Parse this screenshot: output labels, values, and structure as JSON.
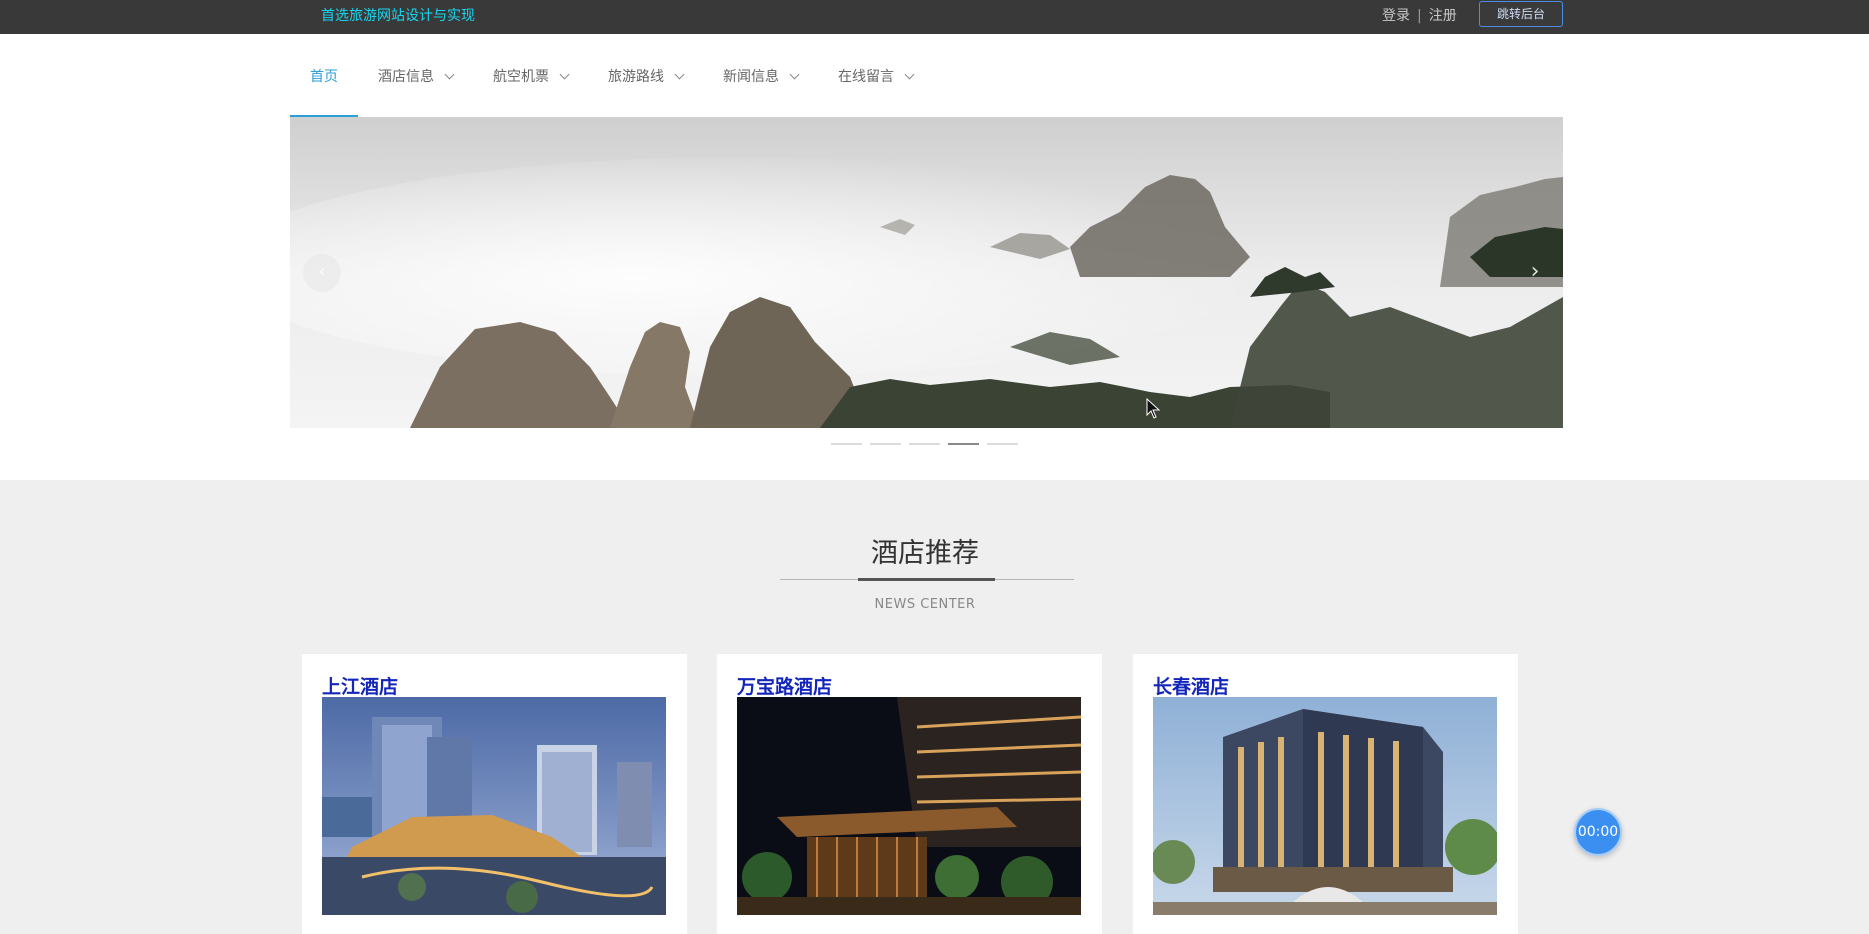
{
  "topbar": {
    "site_title": "首选旅游网站设计与实现",
    "login": "登录",
    "separator": "|",
    "register": "注册",
    "admin_button": "跳转后台"
  },
  "nav": {
    "items": [
      {
        "label": "首页",
        "active": true
      },
      {
        "label": "酒店信息"
      },
      {
        "label": "航空机票"
      },
      {
        "label": "旅游路线"
      },
      {
        "label": "新闻信息"
      },
      {
        "label": "在线留言"
      }
    ]
  },
  "banner": {
    "prev_icon": "‹",
    "next_icon": "›",
    "active_slide": 4,
    "slide_count": 5
  },
  "section": {
    "title": "酒店推荐",
    "subtitle": "NEWS CENTER"
  },
  "cards": [
    {
      "title": "上江酒店"
    },
    {
      "title": "万宝路酒店"
    },
    {
      "title": "长春酒店"
    }
  ],
  "timer": {
    "label": "00:00"
  },
  "colors": {
    "topbar_bg": "#393939",
    "site_title": "#18d6f0",
    "nav_active": "#2c9fd6",
    "card_title": "#1426b9",
    "timer_bg": "#3b8ff0"
  }
}
